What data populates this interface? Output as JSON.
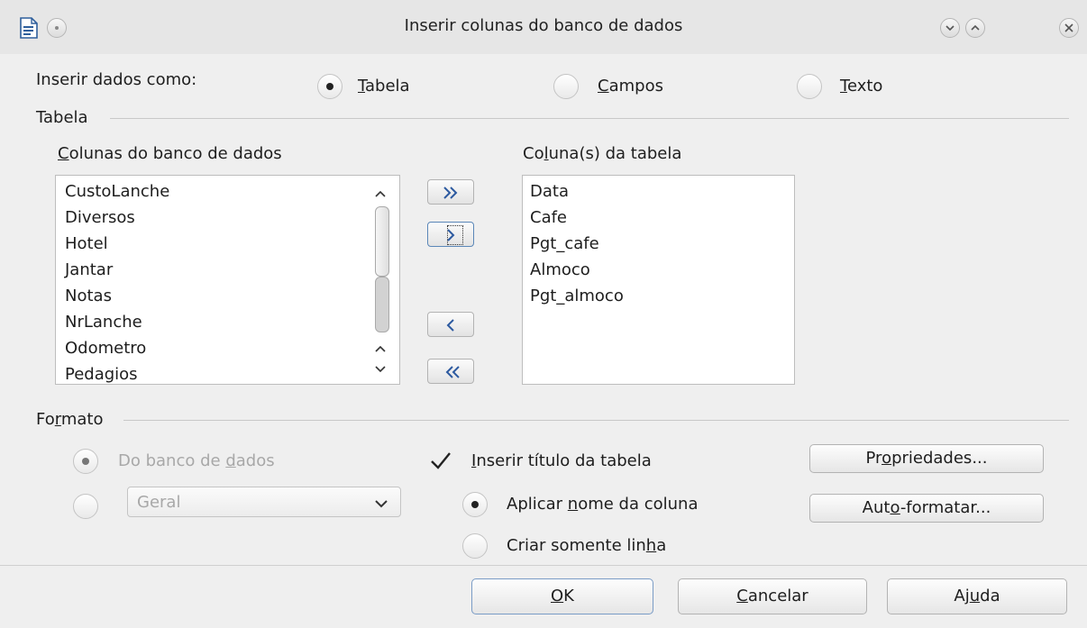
{
  "window": {
    "title": "Inserir colunas do banco de dados"
  },
  "insert_as": {
    "label": "Inserir dados como:",
    "options": [
      {
        "pre": "",
        "u": "T",
        "post": "abela",
        "selected": true
      },
      {
        "pre": "",
        "u": "C",
        "post": "ampos",
        "selected": false
      },
      {
        "pre": "",
        "u": "T",
        "post": "exto",
        "selected": false
      }
    ]
  },
  "table_group": {
    "label": "Tabela",
    "db_columns": {
      "label": {
        "pre": "",
        "u": "C",
        "post": "olunas do banco de dados"
      },
      "items": [
        "CustoLanche",
        "Diversos",
        "Hotel",
        "Jantar",
        "Notas",
        "NrLanche",
        "Odometro",
        "Pedagios"
      ]
    },
    "table_columns": {
      "label": {
        "pre": "Co",
        "u": "l",
        "post": "una(s) da tabela"
      },
      "items": [
        "Data",
        "Cafe",
        "Pgt_cafe",
        "Almoco",
        "Pgt_almoco"
      ]
    }
  },
  "format_group": {
    "label": {
      "pre": "Fo",
      "u": "r",
      "post": "mato"
    },
    "from_db": {
      "pre": "Do banco de ",
      "u": "d",
      "post": "ados",
      "selected": true,
      "enabled": false
    },
    "format_combo": {
      "value": "Geral",
      "enabled": false
    },
    "insert_title": {
      "pre": "",
      "u": "I",
      "post": "nserir título da tabela",
      "checked": true
    },
    "apply_column_name": {
      "pre": "Aplicar ",
      "u": "n",
      "post": "ome da coluna",
      "selected": true
    },
    "create_row_only": {
      "pre": "Criar somente lin",
      "u": "h",
      "post": "a",
      "selected": false
    },
    "properties_button": {
      "pre": "Pr",
      "u": "o",
      "post": "priedades..."
    },
    "autoformat_button": {
      "pre": "Aut",
      "u": "o",
      "post": "-formatar..."
    }
  },
  "buttons": {
    "ok": {
      "pre": "",
      "u": "O",
      "post": "K"
    },
    "cancel": {
      "pre": "",
      "u": "C",
      "post": "ancelar"
    },
    "help": {
      "pre": "Aj",
      "u": "u",
      "post": "da"
    }
  }
}
